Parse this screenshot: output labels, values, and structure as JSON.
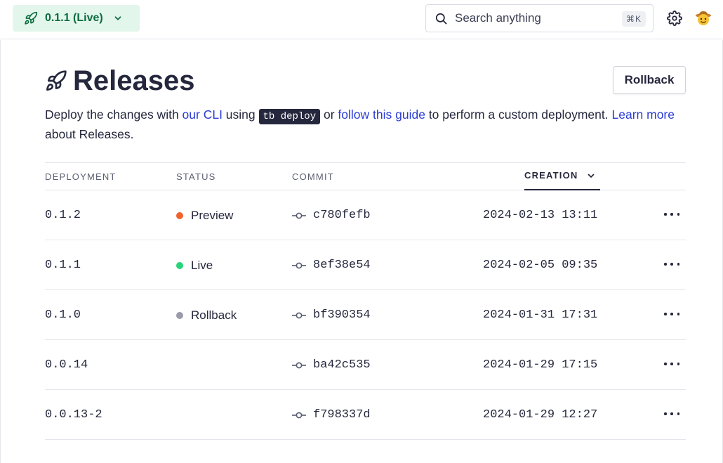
{
  "topbar": {
    "version_label": "0.1.1 (Live)",
    "search_placeholder": "Search anything",
    "search_shortcut": "⌘K"
  },
  "page": {
    "title": "Releases",
    "rollback_button": "Rollback",
    "description": {
      "part1": "Deploy the changes with ",
      "link_cli": "our CLI",
      "part2": " using ",
      "code": "tb deploy",
      "part3": " or ",
      "link_guide": "follow this guide",
      "part4": " to perform a custom deployment. ",
      "link_learn": "Learn more",
      "part5": " about Releases."
    }
  },
  "table": {
    "headers": {
      "deployment": "DEPLOYMENT",
      "status": "STATUS",
      "commit": "COMMIT",
      "creation": "CREATION"
    },
    "rows": [
      {
        "deployment": "0.1.2",
        "status": "Preview",
        "status_color": "#f2622e",
        "commit": "c780fefb",
        "created": "2024-02-13 13:11"
      },
      {
        "deployment": "0.1.1",
        "status": "Live",
        "status_color": "#27d479",
        "commit": "8ef38e54",
        "created": "2024-02-05 09:35"
      },
      {
        "deployment": "0.1.0",
        "status": "Rollback",
        "status_color": "#9a9cab",
        "commit": "bf390354",
        "created": "2024-01-31 17:31"
      },
      {
        "deployment": "0.0.14",
        "status": "",
        "status_color": "",
        "commit": "ba42c535",
        "created": "2024-01-29 17:15"
      },
      {
        "deployment": "0.0.13-2",
        "status": "",
        "status_color": "",
        "commit": "f798337d",
        "created": "2024-01-29 12:27"
      }
    ]
  },
  "colors": {
    "accent_green": "#0a6b3e",
    "link_blue": "#2a3bd6",
    "text_dark": "#25283d"
  },
  "icons": [
    "rocket-icon",
    "chevron-down-icon",
    "search-icon",
    "gear-icon",
    "avatar-icon",
    "commit-icon",
    "more-icon"
  ]
}
